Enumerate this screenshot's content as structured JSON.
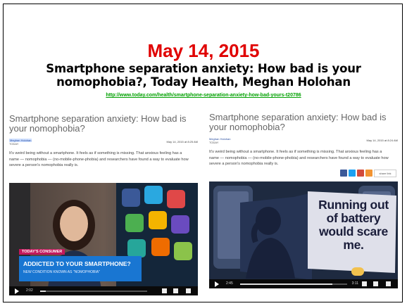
{
  "slide": {
    "date": "May 14, 2015",
    "headline": "Smartphone separation anxiety: How bad is your nomophobia?, Today Health, Meghan Holohan",
    "url": "http://www.today.com/health/smartphone-separation-anxiety-how-bad-yours-t20786"
  },
  "left_screenshot": {
    "article_title": "Smartphone separation anxiety: How bad is your nomophobia?",
    "byline": "Meghan Holohan",
    "outlet": "TODAY",
    "date": "May 14, 2015 at 8:25 AM",
    "body": "It's weird being without a smartphone. It feels as if something is missing. That anxious feeling has a name — nomophobia — (no-mobile-phone-phobia) and researchers have found a way to evaluate how severe a person's nomophobia really is.",
    "share_label": "share link",
    "video": {
      "chyron_tag": "TODAY'S CONSUMER",
      "chyron_title": "ADDICTED TO YOUR SMARTPHONE?",
      "chyron_sub": "NEW CONDITION KNOWN AS \"NOMOPHOBIA\"",
      "time_current": "2:02",
      "time_total": "",
      "progress": 0.05
    }
  },
  "right_screenshot": {
    "article_title": "Smartphone separation anxiety: How bad is your nomophobia?",
    "byline": "Meghan Holohan",
    "outlet": "TODAY",
    "date": "May 14, 2015 at 8:24 AM",
    "body": "It's weird being without a smartphone. It feels as if something is missing. That anxious feeling has a name — nomophobia — (no-mobile-phone-phobia) and researchers have found a way to evaluate how severe a person's nomophobia really is.",
    "share_label": "share link",
    "video": {
      "overlay_text": "Running out of battery would scare me.",
      "time_current": "2:45",
      "time_total": "3:11",
      "progress": 0.86
    }
  },
  "colors": {
    "date": "#e00000",
    "url": "#00a000",
    "facebook": "#3b5998",
    "twitter": "#1da1f2",
    "email": "#d24b3c",
    "rss": "#f29433",
    "chyron_blue": "#1976d2",
    "chyron_tag": "#c2185b"
  }
}
